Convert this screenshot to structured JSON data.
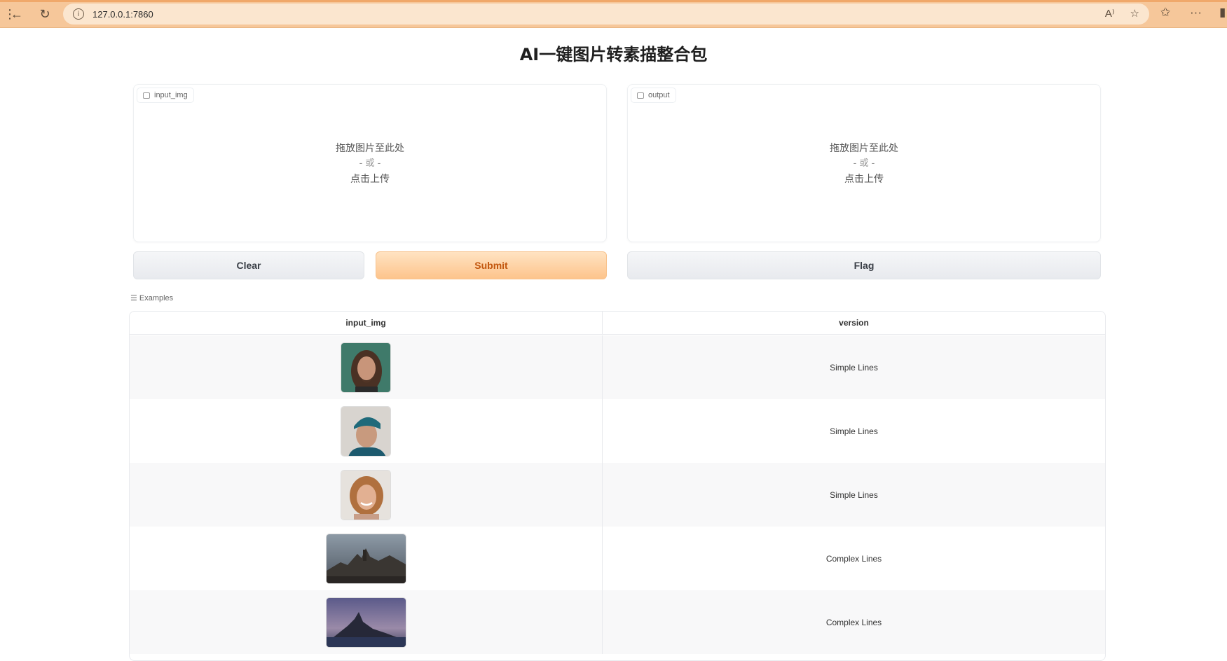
{
  "browser": {
    "url": "127.0.0.1:7860",
    "info_glyph": "i"
  },
  "page": {
    "title": "AI一键图片转素描整合包"
  },
  "input_panel": {
    "label": "input_img",
    "drop_text": "拖放图片至此处",
    "or_text": "- 或 -",
    "click_text": "点击上传"
  },
  "output_panel": {
    "label": "output",
    "drop_text": "拖放图片至此处",
    "or_text": "- 或 -",
    "click_text": "点击上传"
  },
  "buttons": {
    "clear": "Clear",
    "submit": "Submit",
    "flag": "Flag"
  },
  "examples": {
    "label": "Examples",
    "headers": [
      "input_img",
      "version"
    ],
    "rows": [
      {
        "image": "portrait-man-long-hair",
        "version": "Simple Lines"
      },
      {
        "image": "portrait-man-teal-cap",
        "version": "Simple Lines"
      },
      {
        "image": "portrait-woman-smiling",
        "version": "Simple Lines"
      },
      {
        "image": "landscape-castle-cloudy",
        "version": "Complex Lines"
      },
      {
        "image": "landscape-island-dusk",
        "version": "Complex Lines"
      }
    ]
  },
  "colors": {
    "accent": "#fdc48c",
    "accent_text": "#c2560d",
    "browser_bar": "#f6c79a"
  }
}
